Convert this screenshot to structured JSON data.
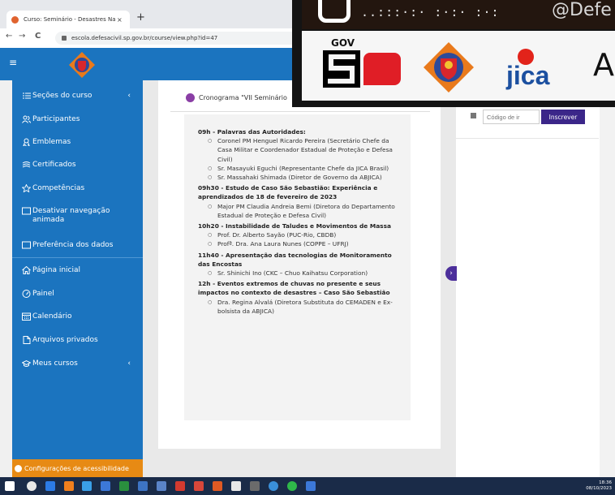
{
  "browser": {
    "tab_title": "Curso: Seminário - Desastres Na",
    "tab_close": "×",
    "new_tab": "+",
    "back": "←",
    "forward": "→",
    "reload": "C",
    "url": "escola.defesacivil.sp.gov.br/course/view.php?id=47"
  },
  "header": {
    "menu_icon": "≡"
  },
  "sidebar": {
    "items": [
      {
        "label": "Seções do curso",
        "icon": "list-icon",
        "chevron": "‹"
      },
      {
        "label": "Participantes",
        "icon": "users-icon"
      },
      {
        "label": "Emblemas",
        "icon": "badge-icon"
      },
      {
        "label": "Certificados",
        "icon": "certificate-icon"
      },
      {
        "label": "Competências",
        "icon": "star-icon"
      },
      {
        "label": "Desativar navegação animada",
        "icon": "square-icon"
      },
      {
        "label": "Preferência dos dados",
        "icon": "square-icon"
      },
      {
        "label": "Página inicial",
        "icon": "home-icon"
      },
      {
        "label": "Painel",
        "icon": "dashboard-icon"
      },
      {
        "label": "Calendário",
        "icon": "calendar-icon"
      },
      {
        "label": "Arquivos privados",
        "icon": "files-icon"
      },
      {
        "label": "Meus cursos",
        "icon": "graduation-cap-icon",
        "chevron": "‹"
      }
    ],
    "accessibility": "Configurações de acessibilidade"
  },
  "card": {
    "title": "Cronograma \"VII Seminário",
    "schedule": [
      {
        "heading": "09h - Palavras das Autoridades:",
        "items": [
          "Coronel PM Henguel Ricardo Pereira (Secretário Chefe da Casa Militar e Coordenador Estadual de Proteção e Defesa Civil)",
          "Sr. Masayuki Eguchi (Representante Chefe da JICA Brasil)",
          "Sr. Massahaki Shimada (Diretor de Governo da ABJICA)"
        ]
      },
      {
        "heading": "09h30 - Estudo de Caso São Sebastião: Experiência e aprendizados de 18 de fevereiro de 2023",
        "items": [
          "Major PM Claudia Andreia Bemi (Diretora do Departamento Estadual de Proteção e Defesa Civil)"
        ]
      },
      {
        "heading": "10h20 - Instabilidade de Taludes e Movimentos de Massa",
        "items": [
          "Prof. Dr. Alberto Sayão (PUC-Rio, CBDB)",
          "Profª. Dra. Ana Laura Nunes (COPPE – UFRJ)"
        ]
      },
      {
        "heading": "11h40 - Apresentação das tecnologias de Monitoramento das Encostas",
        "items": [
          "Sr. Shinichi Ino (CKC – Chuo Kaihatsu Corporation)"
        ]
      },
      {
        "heading": "12h - Eventos extremos de chuvas no presente e seus impactos no contexto de desastres – Caso São Sebastião",
        "items": [
          "Dra. Regina Alvalá (Diretora Substituta do CEMADEN e Ex-bolsista da ABJICA)"
        ]
      }
    ]
  },
  "enrol": {
    "placeholder": "Código de ir",
    "button": "Inscrever"
  },
  "drawer_toggle": "›",
  "banner": {
    "dots": "..:::·:· :·:· :·:",
    "handle": "@Defe",
    "gov_label": "GOV",
    "jica": "jica",
    "trail": "A"
  },
  "taskbar": {
    "time": "18:36",
    "date": "08/10/2023"
  },
  "colors": {
    "sidebar": "#1b74bf",
    "accent_purple": "#3b2689",
    "accessibility_orange": "#e78a14",
    "gov_red": "#e01e26"
  }
}
